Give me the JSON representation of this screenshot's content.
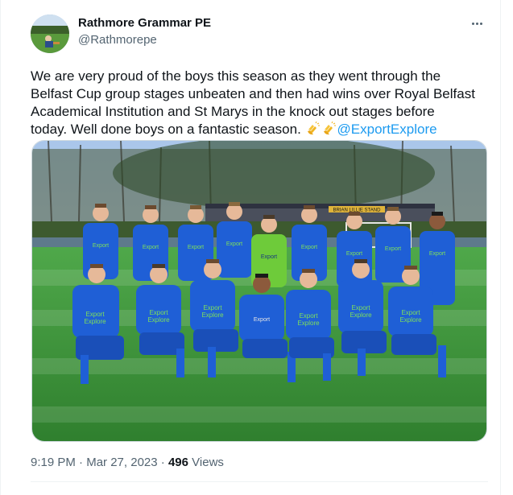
{
  "author": {
    "name": "Rathmore Grammar PE",
    "handle": "@Rathmorepe"
  },
  "tweet": {
    "line1": "We are very proud of the boys this season as they went through the",
    "line2": "Belfast Cup group stages unbeaten and then had wins over Royal Belfast",
    "line3": "Academical Institution and St Marys in the knock out stages before",
    "line4": "today. Well done boys on a fantastic season. ",
    "emoji": "clapping-hands-icon",
    "mention": "@ExportExplore"
  },
  "photo": {
    "signage": "BRIAN LILLIE STAND",
    "shirt_sponsor_line1": "Export",
    "shirt_sponsor_line2": "Explore",
    "keeper_sponsor": "Export"
  },
  "meta": {
    "time": "9:19 PM",
    "separator": "·",
    "date": "Mar 27, 2023",
    "views_count": "496",
    "views_label": "Views"
  },
  "colors": {
    "kit_blue": "#1f5fd6",
    "keeper_green": "#6ecb3a",
    "pitch": "#3f9a3a",
    "link": "#1d9bf0"
  }
}
